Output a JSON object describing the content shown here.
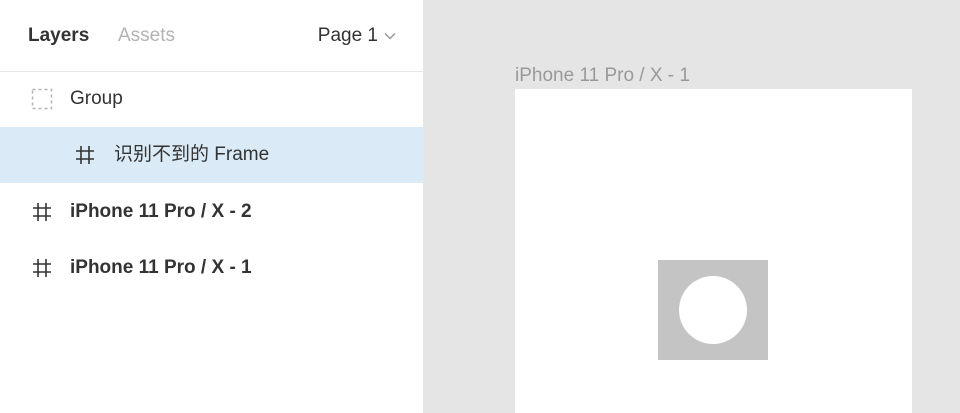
{
  "panel": {
    "tabs": [
      {
        "label": "Layers",
        "active": true
      },
      {
        "label": "Assets",
        "active": false
      }
    ],
    "page_selector": {
      "value": "Page 1",
      "icon": "chevron-down-icon"
    }
  },
  "layers": [
    {
      "name": "Group",
      "icon": "group-dashed-icon",
      "selected": false,
      "bold": false
    },
    {
      "name": "识别不到的 Frame",
      "icon": "frame-hash-icon",
      "selected": true,
      "bold": false
    },
    {
      "name": "iPhone 11 Pro / X - 2",
      "icon": "frame-hash-icon",
      "selected": false,
      "bold": true
    },
    {
      "name": "iPhone 11 Pro / X - 1",
      "icon": "frame-hash-icon",
      "selected": false,
      "bold": true
    }
  ],
  "canvas": {
    "frame_title": "iPhone 11 Pro / X - 1"
  },
  "colors": {
    "selection": "#daebf7",
    "canvas_bg": "#e5e5e5",
    "shape_fill": "#c4c4c4"
  }
}
